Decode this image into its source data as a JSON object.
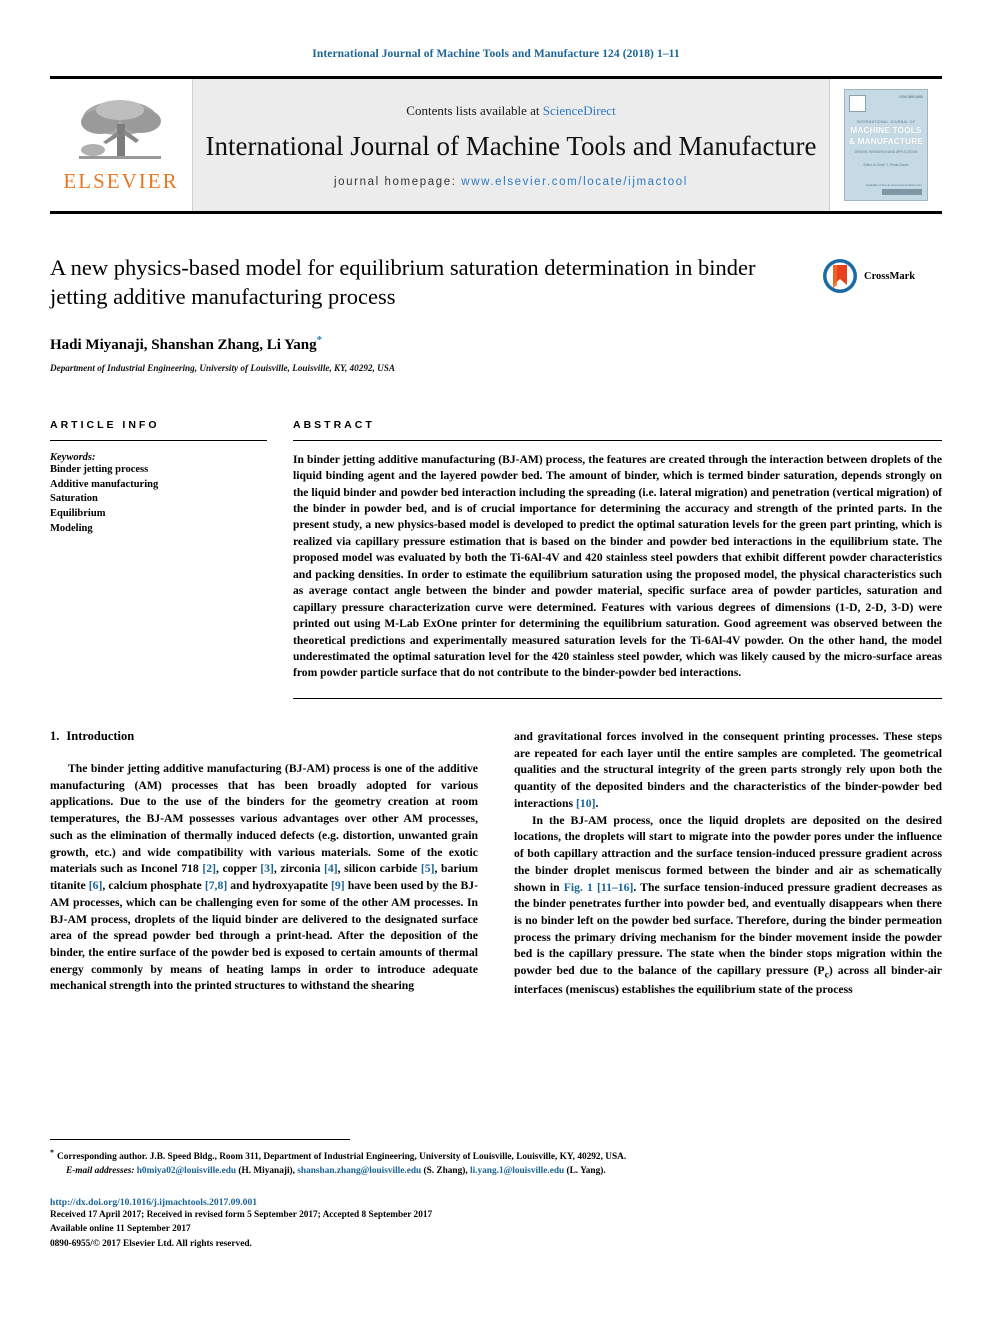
{
  "running_head": "International Journal of Machine Tools and Manufacture 124 (2018) 1–11",
  "masthead": {
    "contents_prefix": "Contents lists available at ",
    "contents_link": "ScienceDirect",
    "journal_title": "International Journal of Machine Tools and Manufacture",
    "homepage_label": "journal homepage:",
    "homepage_url": "www.elsevier.com/locate/ijmactool",
    "publisher_name": "ELSEVIER",
    "cover": {
      "issn": "ISSN 0890-6955",
      "kicker": "INTERNATIONAL JOURNAL OF",
      "line1": "MACHINE TOOLS",
      "line2": "& MANUFACTURE",
      "subtitle": "DESIGN, RESEARCH AND APPLICATION",
      "editors": "Editor-in-Chief:  J. Paulo Davim",
      "footer_text": "Available online at www.sciencedirect.com",
      "brand": "ELSEVIER"
    }
  },
  "article": {
    "title": "A new physics-based model for equilibrium saturation determination in binder jetting additive manufacturing process",
    "authors": "Hadi Miyanaji, Shanshan Zhang, Li Yang",
    "corresponding_marker": "*",
    "affiliation": "Department of Industrial Engineering, University of Louisville, Louisville, KY, 40292, USA",
    "crossmark_label": "CrossMark"
  },
  "article_info": {
    "heading": "ARTICLE INFO",
    "keywords_label": "Keywords:",
    "keywords": [
      "Binder jetting process",
      "Additive manufacturing",
      "Saturation",
      "Equilibrium",
      "Modeling"
    ]
  },
  "abstract": {
    "heading": "ABSTRACT",
    "text": "In binder jetting additive manufacturing (BJ-AM) process, the features are created through the interaction between droplets of the liquid binding agent and the layered powder bed. The amount of binder, which is termed binder saturation, depends strongly on the liquid binder and powder bed interaction including the spreading (i.e. lateral migration) and penetration (vertical migration) of the binder in powder bed, and is of crucial importance for determining the accuracy and strength of the printed parts. In the present study, a new physics-based model is developed to predict the optimal saturation levels for the green part printing, which is realized via capillary pressure estimation that is based on the binder and powder bed interactions in the equilibrium state. The proposed model was evaluated by both the Ti-6Al-4V and 420 stainless steel powders that exhibit different powder characteristics and packing densities. In order to estimate the equilibrium saturation using the proposed model, the physical characteristics such as average contact angle between the binder and powder material, specific surface area of powder particles, saturation and capillary pressure characterization curve were determined. Features with various degrees of dimensions (1-D, 2-D, 3-D) were printed out using M-Lab ExOne printer for determining the equilibrium saturation. Good agreement was observed between the theoretical predictions and experimentally measured saturation levels for the Ti-6Al-4V powder. On the other hand, the model underestimated the optimal saturation level for the 420 stainless steel powder, which was likely caused by the micro-surface areas from powder particle surface that do not contribute to the binder-powder bed interactions."
  },
  "introduction": {
    "number": "1.",
    "title": "Introduction",
    "left_html": "The binder jetting additive manufacturing (BJ-AM) process is one of the additive manufacturing (AM) processes that has been broadly adopted for various applications. Due to the use of the binders for the geometry creation at room temperatures, the BJ-AM possesses various advantages over other AM processes, such as the elimination of thermally induced defects (e.g. distortion, unwanted grain growth, etc.) and wide compatibility with various materials. Some of the exotic materials such as Inconel 718 [2], copper [3], zirconia [4], silicon carbide [5], barium titanite [6], calcium phosphate [7,8] and hydroxyapatite [9] have been used by the BJ-AM processes, which can be challenging even for some of the other AM processes. In BJ-AM process, droplets of the liquid binder are delivered to the designated surface area of the spread powder bed through a print-head. After the deposition of the binder, the entire surface of the powder bed is exposed to certain amounts of thermal energy commonly by means of heating lamps in order to introduce adequate mechanical strength into the printed structures to withstand the shearing",
    "right_html_p1": "and gravitational forces involved in the consequent printing processes. These steps are repeated for each layer until the entire samples are completed. The geometrical qualities and the structural integrity of the green parts strongly rely upon both the quantity of the deposited binders and the characteristics of the binder-powder bed interactions [10].",
    "right_html_p2": "In the BJ-AM process, once the liquid droplets are deposited on the desired locations, the droplets will start to migrate into the powder pores under the influence of both capillary attraction and the surface tension-induced pressure gradient across the binder droplet meniscus formed between the binder and air as schematically shown in Fig. 1 [11–16]. The surface tension-induced pressure gradient decreases as the binder penetrates further into powder bed, and eventually disappears when there is no binder left on the powder bed surface. Therefore, during the binder permeation process the primary driving mechanism for the binder movement inside the powder bed is the capillary pressure. The state when the binder stops migration within the powder bed due to the balance of the capillary pressure (P<sub>c</sub>) across all binder-air interfaces (meniscus) establishes the equilibrium state of the process"
  },
  "footer": {
    "corresponding_note": "Corresponding author. J.B. Speed Bldg., Room 311, Department of Industrial Engineering, University of Louisville, Louisville, KY, 40292, USA.",
    "corresponding_star": "*",
    "email_label": "E-mail addresses:",
    "emails": [
      {
        "address": "h0miya02@louisville.edu",
        "name": "(H. Miyanaji),"
      },
      {
        "address": "shanshan.zhang@louisville.edu",
        "name": "(S. Zhang),"
      },
      {
        "address": "li.yang.1@louisville.edu",
        "name": "(L. Yang)."
      }
    ],
    "doi": "http://dx.doi.org/10.1016/j.ijmachtools.2017.09.001",
    "received": "Received 17 April 2017; Received in revised form 5 September 2017; Accepted 8 September 2017",
    "available": "Available online 11 September 2017",
    "copyright": "0890-6955/© 2017 Elsevier Ltd. All rights reserved."
  },
  "colors": {
    "link": "#1a6496",
    "masthead_link": "#2f7bbf",
    "elsevier_orange": "#E87722",
    "cover_blue": "#c5dae4"
  }
}
